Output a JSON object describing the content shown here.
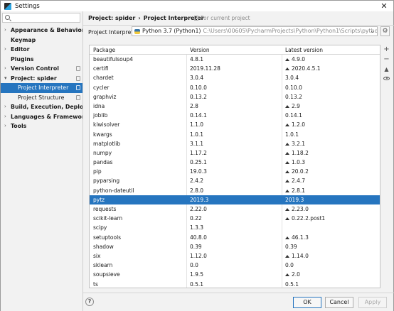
{
  "window": {
    "title": "Settings",
    "close_glyph": "✕"
  },
  "search": {
    "placeholder": ""
  },
  "nav": [
    {
      "label": "Appearance & Behavior",
      "expandable": true,
      "scoped": false
    },
    {
      "label": "Keymap",
      "expandable": false,
      "scoped": false
    },
    {
      "label": "Editor",
      "expandable": true,
      "scoped": false
    },
    {
      "label": "Plugins",
      "expandable": false,
      "scoped": false
    },
    {
      "label": "Version Control",
      "expandable": true,
      "scoped": true
    },
    {
      "label": "Project: spider",
      "expandable": true,
      "expanded": true,
      "scoped": true
    },
    {
      "label": "Project Interpreter",
      "sub": true,
      "selected": true,
      "scoped": true
    },
    {
      "label": "Project Structure",
      "sub": true,
      "scoped": true
    },
    {
      "label": "Build, Execution, Deployment",
      "expandable": true,
      "scoped": false
    },
    {
      "label": "Languages & Frameworks",
      "expandable": true,
      "scoped": false
    },
    {
      "label": "Tools",
      "expandable": true,
      "scoped": false
    }
  ],
  "breadcrumb": {
    "project": "Project: spider",
    "separator": "›",
    "page": "Project Interpreter"
  },
  "for_current_project": "For current project",
  "interpreter": {
    "label": "Project Interpreter:",
    "name": "Python 3.7 (Python1)",
    "path": "C:\\Users\\00605\\PycharmProjects\\Python\\Python1\\Scripts\\python.exe"
  },
  "table": {
    "headers": [
      "Package",
      "Version",
      "Latest version"
    ],
    "rows": [
      {
        "package": "beautifulsoup4",
        "version": "4.8.1",
        "latest": "4.9.0",
        "upgrade": true
      },
      {
        "package": "certifi",
        "version": "2019.11.28",
        "latest": "2020.4.5.1",
        "upgrade": true
      },
      {
        "package": "chardet",
        "version": "3.0.4",
        "latest": "3.0.4",
        "upgrade": false
      },
      {
        "package": "cycler",
        "version": "0.10.0",
        "latest": "0.10.0",
        "upgrade": false
      },
      {
        "package": "graphviz",
        "version": "0.13.2",
        "latest": "0.13.2",
        "upgrade": false
      },
      {
        "package": "idna",
        "version": "2.8",
        "latest": "2.9",
        "upgrade": true
      },
      {
        "package": "joblib",
        "version": "0.14.1",
        "latest": "0.14.1",
        "upgrade": false
      },
      {
        "package": "kiwisolver",
        "version": "1.1.0",
        "latest": "1.2.0",
        "upgrade": true
      },
      {
        "package": "kwargs",
        "version": "1.0.1",
        "latest": "1.0.1",
        "upgrade": false
      },
      {
        "package": "matplotlib",
        "version": "3.1.1",
        "latest": "3.2.1",
        "upgrade": true
      },
      {
        "package": "numpy",
        "version": "1.17.2",
        "latest": "1.18.2",
        "upgrade": true
      },
      {
        "package": "pandas",
        "version": "0.25.1",
        "latest": "1.0.3",
        "upgrade": true
      },
      {
        "package": "pip",
        "version": "19.0.3",
        "latest": "20.0.2",
        "upgrade": true
      },
      {
        "package": "pyparsing",
        "version": "2.4.2",
        "latest": "2.4.7",
        "upgrade": true
      },
      {
        "package": "python-dateutil",
        "version": "2.8.0",
        "latest": "2.8.1",
        "upgrade": true
      },
      {
        "package": "pytz",
        "version": "2019.3",
        "latest": "2019.3",
        "upgrade": false,
        "selected": true
      },
      {
        "package": "requests",
        "version": "2.22.0",
        "latest": "2.23.0",
        "upgrade": true
      },
      {
        "package": "scikit-learn",
        "version": "0.22",
        "latest": "0.22.2.post1",
        "upgrade": true
      },
      {
        "package": "scipy",
        "version": "1.3.3",
        "latest": "",
        "upgrade": false
      },
      {
        "package": "setuptools",
        "version": "40.8.0",
        "latest": "46.1.3",
        "upgrade": true
      },
      {
        "package": "shadow",
        "version": "0.39",
        "latest": "0.39",
        "upgrade": false
      },
      {
        "package": "six",
        "version": "1.12.0",
        "latest": "1.14.0",
        "upgrade": true
      },
      {
        "package": "sklearn",
        "version": "0.0",
        "latest": "0.0",
        "upgrade": false
      },
      {
        "package": "soupsieve",
        "version": "1.9.5",
        "latest": "2.0",
        "upgrade": true
      },
      {
        "package": "ts",
        "version": "0.5.1",
        "latest": "0.5.1",
        "upgrade": false
      },
      {
        "package": "urllib3",
        "version": "1.25.7",
        "latest": "1.25.8",
        "upgrade": true
      }
    ]
  },
  "side_tools": {
    "add": "+",
    "remove": "−",
    "upgrade": "▲"
  },
  "buttons": {
    "help": "?",
    "ok": "OK",
    "cancel": "Cancel",
    "apply": "Apply"
  },
  "colors": {
    "selection": "#2675bf",
    "frame": "#9a9a9a"
  }
}
